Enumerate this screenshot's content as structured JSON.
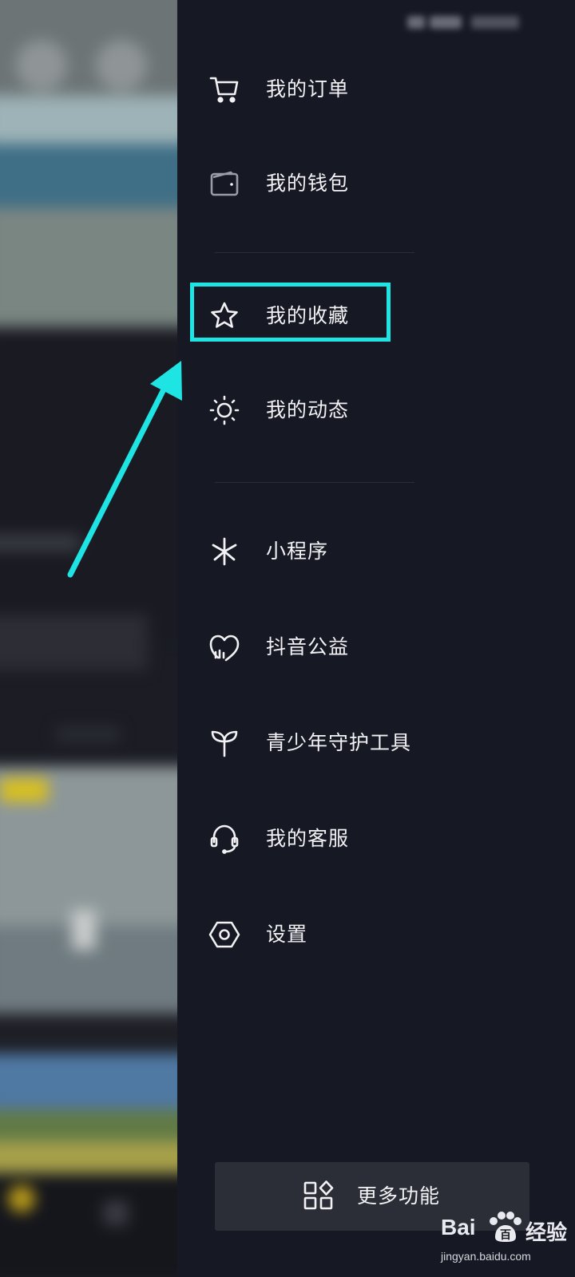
{
  "drawer": {
    "menu_group_1": [
      {
        "label": "我的订单",
        "icon": "cart-icon"
      },
      {
        "label": "我的钱包",
        "icon": "wallet-icon"
      }
    ],
    "menu_group_2": [
      {
        "label": "我的收藏",
        "icon": "star-icon",
        "highlighted": true
      },
      {
        "label": "我的动态",
        "icon": "sun-icon"
      }
    ],
    "menu_group_3": [
      {
        "label": "小程序",
        "icon": "mini-program-icon"
      },
      {
        "label": "抖音公益",
        "icon": "heart-icon"
      },
      {
        "label": "青少年守护工具",
        "icon": "sprout-icon"
      },
      {
        "label": "我的客服",
        "icon": "headset-icon"
      },
      {
        "label": "设置",
        "icon": "settings-hexagon-icon"
      }
    ],
    "more_button": {
      "label": "更多功能",
      "icon": "grid-apps-icon"
    }
  },
  "annotation": {
    "highlight_color": "#1fe4e4",
    "arrow_color": "#1fe4e4"
  },
  "watermark": {
    "logo_left": "Bai",
    "logo_right": "百",
    "brand_cn": "经验",
    "url": "jingyan.baidu.com"
  },
  "colors": {
    "drawer_bg": "#161823",
    "text": "#f2f2f4",
    "button_bg": "#2c2e37"
  }
}
